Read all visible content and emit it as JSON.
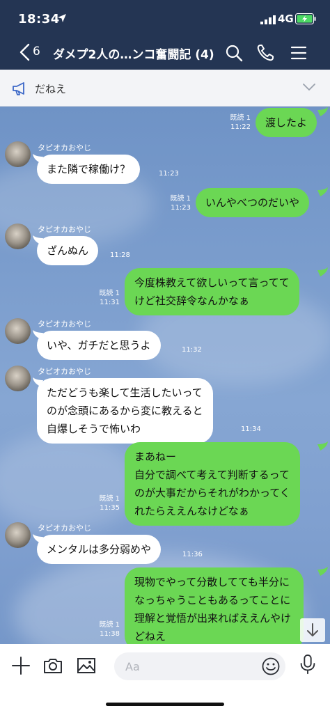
{
  "status_bar": {
    "time": "18:34",
    "network": "4G"
  },
  "header": {
    "unread_count": "6",
    "title": "ダメプ2人の…ンコ奮闘記 (4)"
  },
  "announcement": {
    "text": "だねえ"
  },
  "messages": [
    {
      "from": "me",
      "text": [
        "渡したよ"
      ],
      "read": "既読 1",
      "time": "11:22"
    },
    {
      "from": "other",
      "sender": "タピオカおやじ",
      "text": [
        "また隣で稼働け？"
      ],
      "time": "11:23"
    },
    {
      "from": "me",
      "text": [
        "いんやべつのだいや"
      ],
      "read": "既読 1",
      "time": "11:23"
    },
    {
      "from": "other",
      "sender": "タピオカおやじ",
      "text": [
        "ざんぬん"
      ],
      "time": "11:28"
    },
    {
      "from": "me",
      "text": [
        "今度株教えて欲しいって言ってて",
        "けど社交辞令なんかなぁ"
      ],
      "read": "既読 1",
      "time": "11:31"
    },
    {
      "from": "other",
      "sender": "タピオカおやじ",
      "text": [
        "いや、ガチだと思うよ"
      ],
      "time": "11:32"
    },
    {
      "from": "other",
      "sender": "タピオカおやじ",
      "text": [
        "ただどうも楽して生活したいって",
        "のが念頭にあるから変に教えると",
        "自爆しそうで怖いわ"
      ],
      "time": "11:34"
    },
    {
      "from": "me",
      "text": [
        "まあねー",
        "自分で調べて考えて判断するって",
        "のが大事だからそれがわかってく",
        "れたらええんなけどなぁ"
      ],
      "read": "既読 1",
      "time": "11:35"
    },
    {
      "from": "other",
      "sender": "タピオカおやじ",
      "text": [
        "メンタルは多分弱めや"
      ],
      "time": "11:36"
    },
    {
      "from": "me",
      "text": [
        "現物でやって分散してても半分に",
        "なっちゃうこともあるってことに",
        "理解と覚悟が出来ればええんやけ",
        "どねえ"
      ],
      "read": "既読 1",
      "time": "11:38"
    }
  ],
  "input": {
    "placeholder": "Aa"
  },
  "colors": {
    "header_bg": "#243553",
    "my_bubble": "#6bd754",
    "their_bubble": "#ffffff"
  },
  "icons": [
    "back-icon",
    "search-icon",
    "phone-icon",
    "menu-icon",
    "megaphone-icon",
    "chevron-down-icon",
    "plus-icon",
    "camera-icon",
    "image-icon",
    "emoji-icon",
    "mic-icon",
    "arrow-down-icon"
  ]
}
